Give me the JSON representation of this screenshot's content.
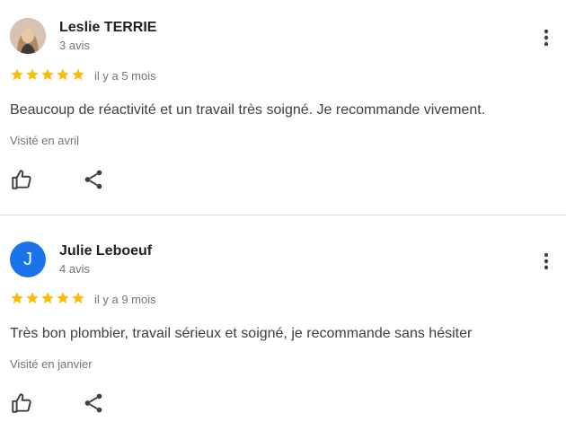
{
  "reviews": [
    {
      "author": "Leslie TERRIE",
      "review_count": "3 avis",
      "rating": 5,
      "time": "il y a 5 mois",
      "text": "Beaucoup de réactivité et un travail très soigné. Je recommande vivement.",
      "visited": "Visité en avril",
      "avatar_type": "photo"
    },
    {
      "author": "Julie Leboeuf",
      "review_count": "4 avis",
      "rating": 5,
      "time": "il y a 9 mois",
      "text": "Très bon plombier, travail sérieux et soigné, je recommande sans hésiter",
      "visited": "Visité en janvier",
      "avatar_type": "letter",
      "avatar_letter": "J"
    }
  ],
  "colors": {
    "star": "#fbbc04",
    "avatar_letter_bg": "#1a73e8",
    "secondary_text": "#70757a",
    "icon": "#3c4043"
  },
  "icons": [
    "more-vert-icon",
    "star-icon",
    "thumb-up-icon",
    "share-icon"
  ]
}
